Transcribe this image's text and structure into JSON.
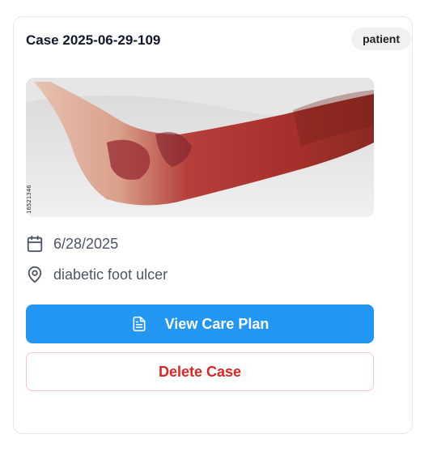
{
  "card": {
    "title": "Case 2025-06-29-109",
    "badge": "patient",
    "image_alt": "Photo of leg with diabetic foot ulcer",
    "date": "6/28/2025",
    "location": "diabetic foot ulcer",
    "view_care_plan_label": "View Care Plan",
    "delete_case_label": "Delete Case"
  },
  "icons": {
    "date": "calendar-icon",
    "location": "map-pin-icon",
    "care_plan": "document-icon"
  },
  "colors": {
    "primary": "#2196f3",
    "danger": "#dc2626",
    "text_muted": "#4b5563"
  }
}
